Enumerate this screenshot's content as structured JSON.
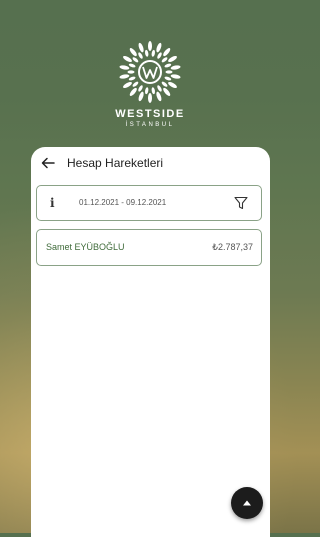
{
  "brand": {
    "name": "WESTSIDE",
    "sub": "İSTANBUL"
  },
  "header": {
    "title": "Hesap Hareketleri",
    "back_icon": "arrow-left-icon"
  },
  "filter": {
    "info_label": "i",
    "date_range": "01.12.2021 - 09.12.2021",
    "filter_icon": "funnel-icon"
  },
  "transactions": [
    {
      "name": "Samet EYÜBOĞLU",
      "amount": "₺2.787,37"
    }
  ],
  "fab": {
    "icon": "arrow-up-icon"
  },
  "colors": {
    "accent": "#3f6b3a",
    "border": "#8aa287"
  }
}
